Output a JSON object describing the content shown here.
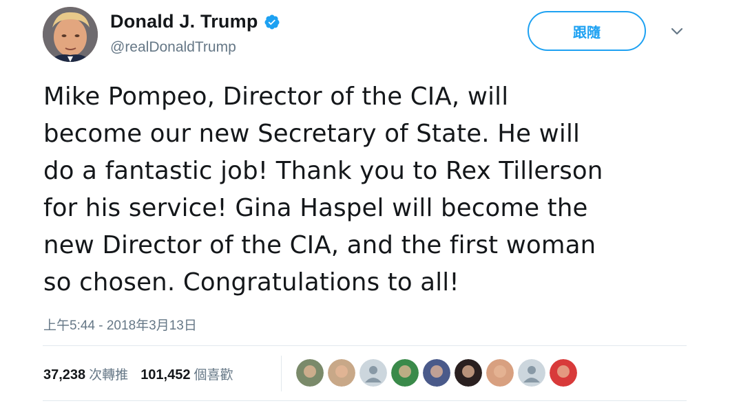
{
  "author": {
    "display_name": "Donald J. Trump",
    "handle": "@realDonaldTrump",
    "verified": true
  },
  "header": {
    "follow_label": "跟隨",
    "caret_icon": "chevron-down-icon"
  },
  "tweet": {
    "lines": [
      "Mike Pompeo, Director of the CIA, will",
      "become our new Secretary of State. He will",
      "do a fantastic job! Thank you to Rex Tillerson",
      "for his service! Gina Haspel will become the",
      "new Director of the CIA, and the first woman",
      "so chosen. Congratulations to all!"
    ],
    "timestamp": "上午5:44 - 2018年3月13日"
  },
  "stats": {
    "retweets_count": "37,238",
    "retweets_label": "次轉推",
    "likes_count": "101,452",
    "likes_label": "個喜歡"
  },
  "likers": [
    {
      "name": "liker-avatar",
      "color": "#7a8a6a"
    },
    {
      "name": "liker-avatar",
      "color": "#c8a888"
    },
    {
      "name": "liker-avatar-default",
      "color": "#ccd6dd"
    },
    {
      "name": "liker-avatar",
      "color": "#3a8a4a"
    },
    {
      "name": "liker-avatar",
      "color": "#4a5a8a"
    },
    {
      "name": "liker-avatar",
      "color": "#2a2020"
    },
    {
      "name": "liker-avatar",
      "color": "#d8a080"
    },
    {
      "name": "liker-avatar-default",
      "color": "#ccd6dd"
    },
    {
      "name": "liker-avatar",
      "color": "#d83a3a"
    }
  ],
  "colors": {
    "accent": "#1da1f2",
    "secondary_text": "#657786",
    "primary_text": "#14171a",
    "divider": "#e1e8ed"
  }
}
